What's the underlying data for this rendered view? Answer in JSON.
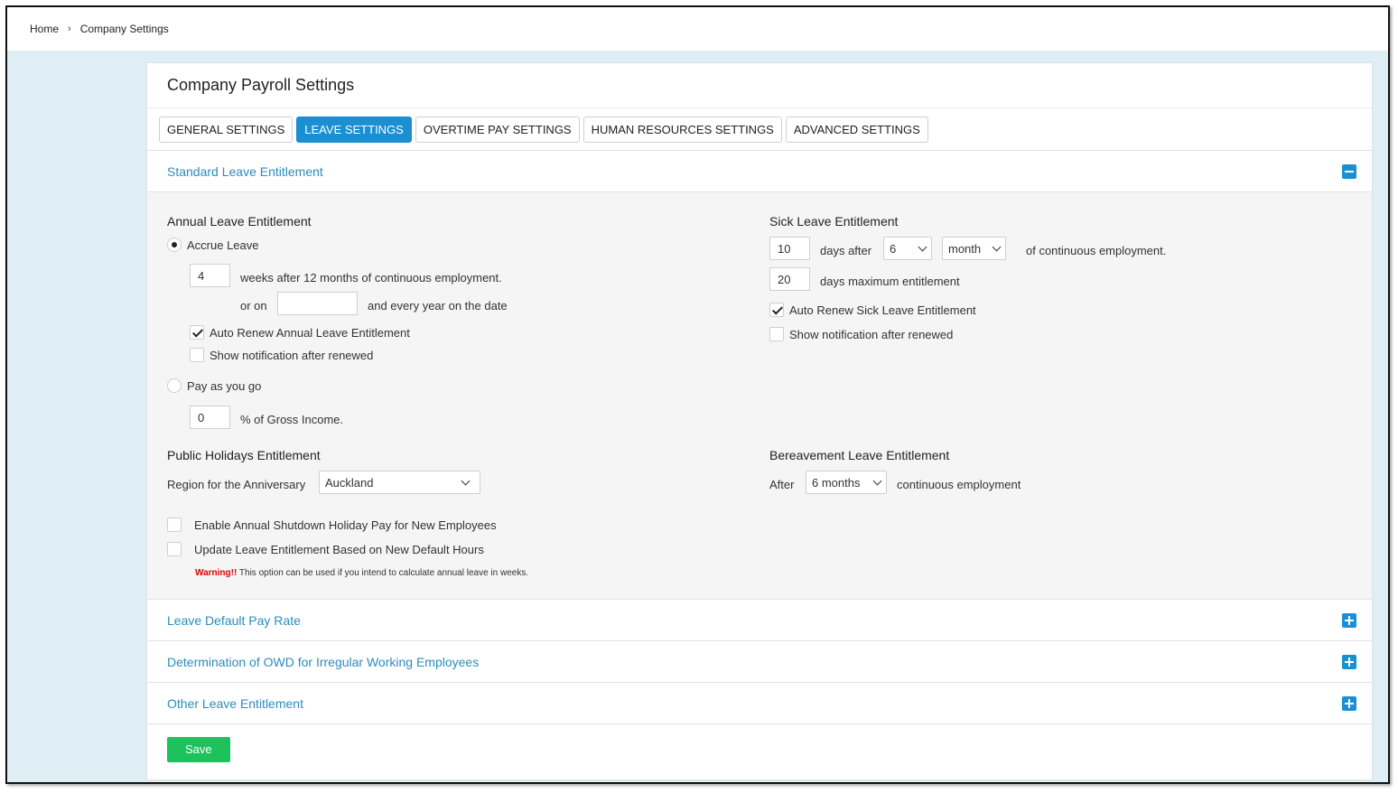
{
  "breadcrumb": {
    "home": "Home",
    "separator": "›",
    "current": "Company Settings"
  },
  "page_title": "Company Payroll Settings",
  "tabs": [
    {
      "label": "GENERAL SETTINGS",
      "active": false
    },
    {
      "label": "LEAVE SETTINGS",
      "active": true
    },
    {
      "label": "OVERTIME PAY SETTINGS",
      "active": false
    },
    {
      "label": "HUMAN RESOURCES SETTINGS",
      "active": false
    },
    {
      "label": "ADVANCED SETTINGS",
      "active": false
    }
  ],
  "sections": {
    "standard": {
      "title": "Standard Leave Entitlement",
      "expanded": true
    },
    "default_pay_rate": {
      "title": "Leave Default Pay Rate",
      "expanded": false
    },
    "owd": {
      "title": "Determination of OWD for Irregular Working Employees",
      "expanded": false
    },
    "other": {
      "title": "Other Leave Entitlement",
      "expanded": false
    }
  },
  "annual": {
    "heading": "Annual Leave Entitlement",
    "accrue_label": "Accrue Leave",
    "accrue_selected": true,
    "weeks_value": "4",
    "weeks_text": "weeks after 12 months of continuous employment.",
    "or_on_label": "or on",
    "date_value": "",
    "every_year_text": "and every year on the date",
    "auto_renew_label": "Auto Renew Annual Leave Entitlement",
    "auto_renew_checked": true,
    "show_notification_label": "Show notification after renewed",
    "show_notification_checked": false,
    "payg_label": "Pay as you go",
    "payg_selected": false,
    "percent_value": "0",
    "percent_text": "% of Gross Income."
  },
  "sick": {
    "heading": "Sick Leave Entitlement",
    "days_value": "10",
    "days_after_text": "days after",
    "period_value": "6",
    "unit_value": "month",
    "continuous_text": "of continuous employment.",
    "max_value": "20",
    "max_text": "days maximum entitlement",
    "auto_renew_label": "Auto Renew Sick Leave Entitlement",
    "auto_renew_checked": true,
    "show_notification_label": "Show notification after renewed",
    "show_notification_checked": false
  },
  "public_holidays": {
    "heading": "Public Holidays Entitlement",
    "region_label": "Region for the Anniversary",
    "region_value": "Auckland"
  },
  "bereavement": {
    "heading": "Bereavement Leave Entitlement",
    "after_label": "After",
    "after_value": "6 months",
    "continuous_text": "continuous employment"
  },
  "options": {
    "shutdown_label": "Enable Annual Shutdown Holiday Pay for New Employees",
    "shutdown_checked": false,
    "update_label": "Update Leave Entitlement Based on New Default Hours",
    "update_checked": false,
    "warning_label": "Warning!!",
    "warning_text": " This option can be used if you intend to calculate annual leave in weeks."
  },
  "save_label": "Save",
  "colors": {
    "accent": "#1a8fd1",
    "link": "#2b8cbd",
    "save": "#1cc35d",
    "warning": "#e00000"
  }
}
